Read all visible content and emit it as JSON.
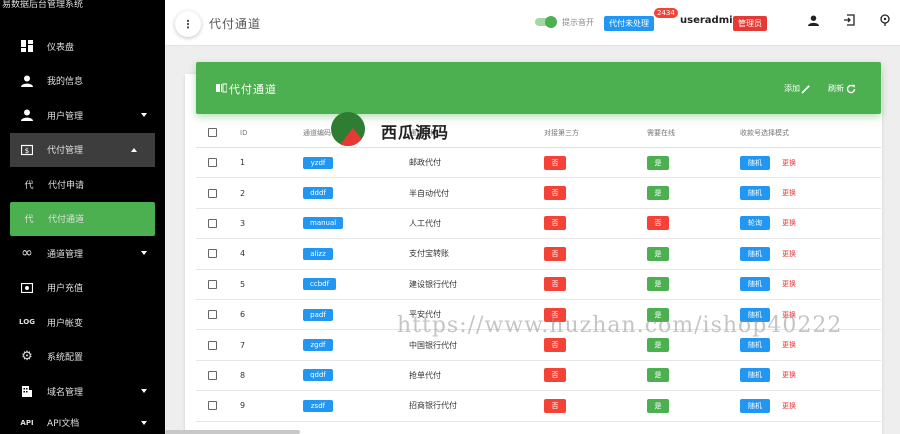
{
  "app": {
    "brand": "易数据后台管理系统"
  },
  "sidebar": {
    "items": [
      {
        "label": "仪表盘",
        "icon": "dashboard-icon"
      },
      {
        "label": "我的信息",
        "icon": "person-icon"
      },
      {
        "label": "用户管理",
        "icon": "person-icon",
        "expandable": true
      },
      {
        "label": "代付管理",
        "icon": "money-icon",
        "expandable": true,
        "expanded": true
      },
      {
        "label": "代付申请",
        "icon": "代",
        "sub": true
      },
      {
        "label": "代付通道",
        "icon": "代",
        "sub": true,
        "active": true
      },
      {
        "label": "通道管理",
        "icon": "infinity-icon",
        "expandable": true
      },
      {
        "label": "用户充值",
        "icon": "payment-icon"
      },
      {
        "label": "用户帐变",
        "icon": "LOG"
      },
      {
        "label": "系统配置",
        "icon": "gear-icon"
      },
      {
        "label": "域名管理",
        "icon": "building-icon",
        "expandable": true
      },
      {
        "label": "API文档",
        "icon": "API",
        "expandable": true
      }
    ]
  },
  "topbar": {
    "menu_glyph": "⋮",
    "title": "代付通道",
    "toggle_label": "提示音开",
    "pending_label": "代付未处理",
    "pending_count": "2434",
    "username": "useradmin",
    "role": "管理员"
  },
  "card": {
    "title": "代付通道",
    "add_label": "添加",
    "refresh_label": "刷新"
  },
  "table": {
    "headers": {
      "id": "ID",
      "code": "通道编码",
      "name": "通道名称",
      "third": "对接第三方",
      "online": "需要在线",
      "mode": "收款号选择模式"
    },
    "rows": [
      {
        "id": "1",
        "code": "yzdf",
        "name": "邮政代付",
        "third": "否",
        "online": "是",
        "mode": "随机",
        "change": "更换"
      },
      {
        "id": "2",
        "code": "dddf",
        "name": "半自动代付",
        "third": "否",
        "online": "是",
        "mode": "随机",
        "change": "更换"
      },
      {
        "id": "3",
        "code": "manual",
        "name": "人工代付",
        "third": "否",
        "online": "否",
        "mode": "轮询",
        "change": "更换"
      },
      {
        "id": "4",
        "code": "alizz",
        "name": "支付宝转账",
        "third": "否",
        "online": "是",
        "mode": "随机",
        "change": "更换"
      },
      {
        "id": "5",
        "code": "ccbdf",
        "name": "建设银行代付",
        "third": "否",
        "online": "是",
        "mode": "随机",
        "change": "更换"
      },
      {
        "id": "6",
        "code": "padf",
        "name": "平安代付",
        "third": "否",
        "online": "是",
        "mode": "随机",
        "change": "更换"
      },
      {
        "id": "7",
        "code": "zgdf",
        "name": "中国银行代付",
        "third": "否",
        "online": "是",
        "mode": "随机",
        "change": "更换"
      },
      {
        "id": "8",
        "code": "qddf",
        "name": "抢单代付",
        "third": "否",
        "online": "是",
        "mode": "随机",
        "change": "更换"
      },
      {
        "id": "9",
        "code": "zsdf",
        "name": "招商银行代付",
        "third": "否",
        "online": "是",
        "mode": "随机",
        "change": "更换"
      }
    ]
  },
  "watermark": {
    "logo_text": "西瓜源码",
    "url": "https://www.huzhan.com/ishop40222"
  },
  "colors": {
    "accent_green": "#4caf50",
    "danger_red": "#f44336",
    "info_blue": "#2196f3",
    "sidebar_bg": "#000000"
  }
}
